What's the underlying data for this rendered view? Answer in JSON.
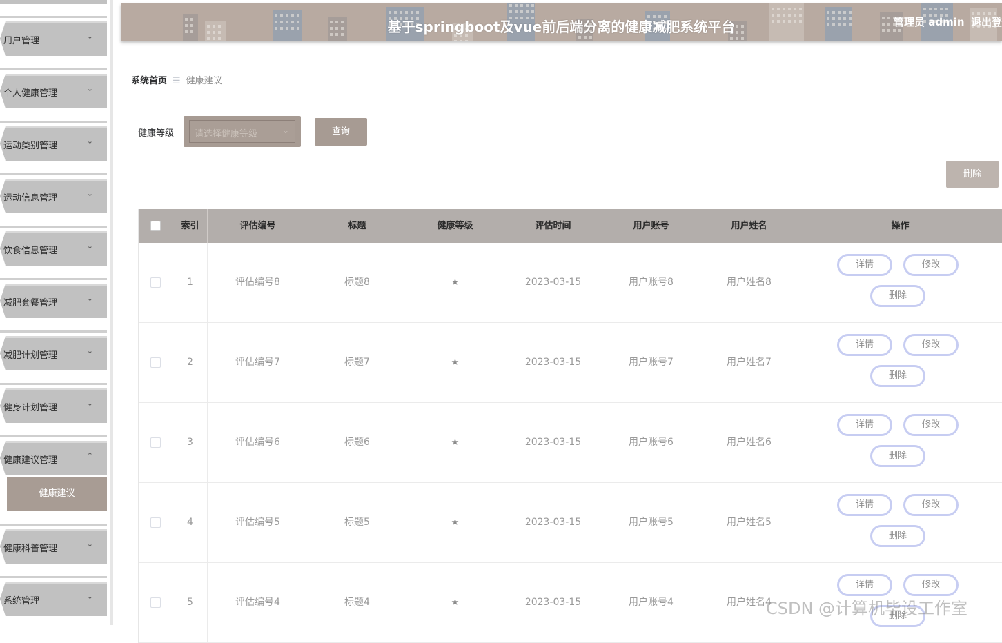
{
  "header": {
    "title": "基于springboot及vue前后端分离的健康减肥系统平台",
    "user": "管理员 admin",
    "logout": "退出登"
  },
  "sidebar": {
    "items": [
      {
        "label": "用户管理",
        "expanded": false
      },
      {
        "label": "个人健康管理",
        "expanded": false
      },
      {
        "label": "运动类别管理",
        "expanded": false
      },
      {
        "label": "运动信息管理",
        "expanded": false
      },
      {
        "label": "饮食信息管理",
        "expanded": false
      },
      {
        "label": "减肥套餐管理",
        "expanded": false
      },
      {
        "label": "减肥计划管理",
        "expanded": false
      },
      {
        "label": "健身计划管理",
        "expanded": false
      },
      {
        "label": "健康建议管理",
        "expanded": true
      },
      {
        "label": "健康科普管理",
        "expanded": false
      },
      {
        "label": "系统管理",
        "expanded": false
      }
    ],
    "submenu_active": "健康建议",
    "arrow_down": "⌄",
    "arrow_up": "⌃"
  },
  "breadcrumb": {
    "home": "系统首页",
    "separator": "☰",
    "current": "健康建议"
  },
  "search": {
    "label": "健康等级",
    "placeholder": "请选择健康等级",
    "query_button": "查询"
  },
  "batch_delete_button": "删除",
  "table": {
    "headers": [
      "索引",
      "评估编号",
      "标题",
      "健康等级",
      "评估时间",
      "用户账号",
      "用户姓名",
      "操作"
    ],
    "rows": [
      {
        "index": "1",
        "code": "评估编号8",
        "title": "标题8",
        "level": "★",
        "time": "2023-03-15",
        "account": "用户账号8",
        "name": "用户姓名8"
      },
      {
        "index": "2",
        "code": "评估编号7",
        "title": "标题7",
        "level": "★",
        "time": "2023-03-15",
        "account": "用户账号7",
        "name": "用户姓名7"
      },
      {
        "index": "3",
        "code": "评估编号6",
        "title": "标题6",
        "level": "★",
        "time": "2023-03-15",
        "account": "用户账号6",
        "name": "用户姓名6"
      },
      {
        "index": "4",
        "code": "评估编号5",
        "title": "标题5",
        "level": "★",
        "time": "2023-03-15",
        "account": "用户账号5",
        "name": "用户姓名5"
      },
      {
        "index": "5",
        "code": "评估编号4",
        "title": "标题4",
        "level": "★",
        "time": "2023-03-15",
        "account": "用户账号4",
        "name": "用户姓名4"
      }
    ],
    "actions": {
      "detail": "详情",
      "edit": "修改",
      "delete": "删除"
    }
  },
  "watermark": "CSDN @计算机毕设工作室",
  "colors": {
    "header_bg": "#b8aaa1",
    "accent": "#a79b93",
    "table_header": "#b3aeab",
    "action_border": "#c7cdf2",
    "sidebar_item": "#c1c1c1"
  }
}
